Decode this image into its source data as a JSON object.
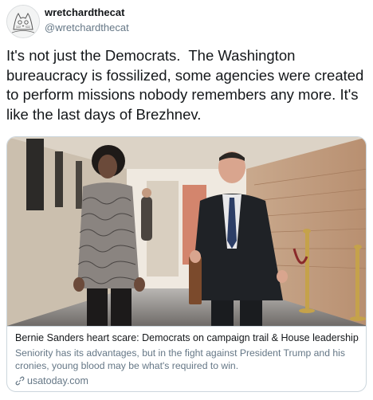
{
  "user": {
    "display_name": "wretchardthecat",
    "handle": "@wretchardthecat",
    "avatar_icon": "cat-sketch-avatar"
  },
  "tweet": {
    "text": "It's not just the Democrats.  The Washington bureaucracy is fossilized, some agencies were created to perform missions nobody remembers any more. It's like the last days of Brezhnev."
  },
  "card": {
    "title": "Bernie Sanders heart scare: Democrats on campaign trail & House leadership...",
    "description": "Seniority has its advantages, but in the fight against President Trump and his cronies, young blood may be what's required to win.",
    "domain": "usatoday.com",
    "link_icon": "link-icon"
  },
  "colors": {
    "text": "#14171a",
    "secondary": "#657786",
    "border": "#ccd6dd"
  }
}
